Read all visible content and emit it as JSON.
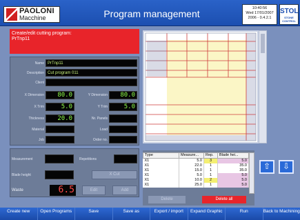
{
  "header": {
    "brand": "PAOLONI",
    "brand_sub": "Macchine",
    "title": "Program management",
    "clock_time": "10:40:56",
    "clock_date": "Wed 17/01/2007",
    "clock_version": "2006 - 0.4.2.1",
    "side_logo": "STOL",
    "side_logo_sub": "STONE CONTROL"
  },
  "program_heading": {
    "line1": "Create/edit cutting program:",
    "line2": "PrTnp11"
  },
  "form": {
    "name_label": "Name",
    "name_value": "PrTnp11",
    "description_label": "Description",
    "description_value": "Cut program 011",
    "client_label": "Client",
    "client_value": "",
    "x_dimension_label": "X Dimension",
    "x_dimension_value": "80.0",
    "y_dimension_label": "Y Dimension",
    "y_dimension_value": "80.0",
    "x_trim_label": "X Trim",
    "x_trim_value": "5.0",
    "y_trim_label": "Y Trim",
    "y_trim_value": "5.0",
    "thickness_label": "Thickness",
    "thickness_value": "20.0",
    "nr_panels_label": "Nr. Panels",
    "nr_panels_value": "",
    "material_label": "Material",
    "material_value": "",
    "load_label": "Load",
    "load_value": "",
    "job_label": "Job",
    "job_value": "",
    "order_label": "Order no.",
    "order_value": ""
  },
  "cut_panel": {
    "measurement_label": "Measurement",
    "repetitions_label": "Repetitions",
    "blade_height_label": "Blade height",
    "x_cut_button": "X Cut",
    "waste_label": "Waste",
    "waste_value": "6.5",
    "edit_button": "Edit",
    "add_button": "Add"
  },
  "cut_table": {
    "headers": [
      "Type",
      "Measure...",
      "Rep.",
      "Blade hei..."
    ],
    "rows": [
      [
        "X1",
        "5.0",
        "3",
        "5.0"
      ],
      [
        "X1",
        "22.0",
        "1",
        "35.0"
      ],
      [
        "X1",
        "15.0",
        "1",
        "35.0"
      ],
      [
        "X1",
        "5.0",
        "1",
        "5.0"
      ],
      [
        "X1",
        "10.0",
        "2",
        "5.0"
      ],
      [
        "X1",
        "25.0",
        "1",
        "5.0"
      ]
    ],
    "delete_button": "Delete",
    "delete_all_button": "Delete all"
  },
  "arrows": {
    "up_icon": "arrow-up-icon",
    "down_icon": "arrow-down-icon"
  },
  "toolbar": [
    "Create new",
    "Open Programs",
    "Save",
    "Save as",
    "Export / import",
    "Expand Graphic",
    "Run",
    "Back to Machining"
  ],
  "colors": {
    "header_blue": "#1c4fb0",
    "alert_red": "#e8242a",
    "panel_gray": "#6d7c98",
    "lcd_green": "#8fff4a",
    "lcd_red": "#ff4a4a"
  }
}
